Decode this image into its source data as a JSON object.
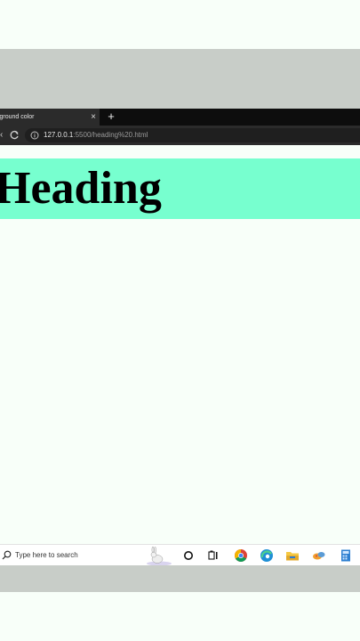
{
  "browser": {
    "tab_title": "kground color",
    "tab_close": "×",
    "new_tab": "+",
    "url_host": "127.0.0.1",
    "url_rest": ":5500/heading%20.html"
  },
  "page": {
    "heading": "Heading",
    "heading_background": "#77ffcf",
    "body_background": "#f8fff9"
  },
  "taskbar": {
    "search_placeholder": "Type here to search",
    "pinned_icons": [
      "cortana-icon",
      "task-view-icon",
      "chrome-icon",
      "edge-icon",
      "file-explorer-icon",
      "paint-icon",
      "calculator-icon"
    ]
  }
}
